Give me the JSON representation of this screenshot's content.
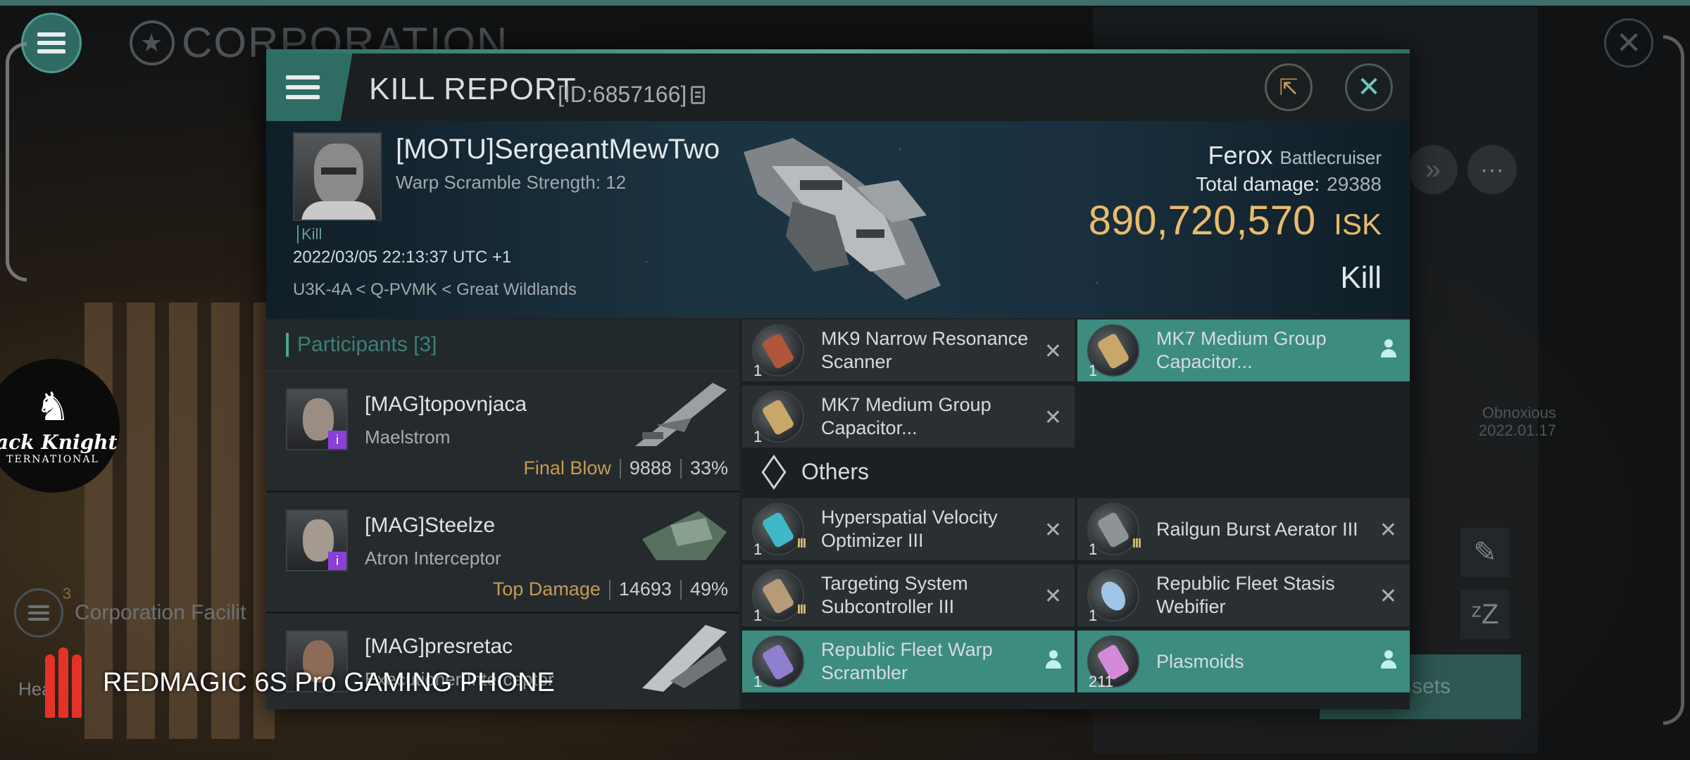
{
  "background": {
    "corp_title": "CORPORATION",
    "facility_label": "Corporation Facilit",
    "facility_count": "3",
    "heat_label": "Hea",
    "obnox_name": "Obnoxious",
    "obnox_date": "2022.01.17",
    "assets_label": "sets",
    "logo_name": "lack Knight",
    "logo_sub": "TERNATIONAL"
  },
  "watermark": "REDMAGIC 6S Pro GAMING PHONE",
  "header": {
    "title": "KILL REPORT",
    "id": "[ID:6857166]"
  },
  "victim": {
    "name": "[MOTU]SergeantMewTwo",
    "warp_scramble": "Warp Scramble Strength: 12",
    "kill_tag": "Kill",
    "datetime": "2022/03/05 22:13:37 UTC +1",
    "location": "U3K-4A < Q-PVMK < Great Wildlands",
    "ship": "Ferox",
    "ship_class": "Battlecruiser",
    "total_damage_label": "Total damage:",
    "total_damage": "29388",
    "isk_value": "890,720,570",
    "isk_unit": "ISK",
    "result": "Kill"
  },
  "participants": {
    "label": "Participants",
    "count": "[3]",
    "rows": [
      {
        "name": "[MAG]topovnjaca",
        "ship": "Maelstrom",
        "tag": "Final Blow",
        "damage": "9888",
        "percent": "33%"
      },
      {
        "name": "[MAG]Steelze",
        "ship": "Atron Interceptor",
        "tag": "Top Damage",
        "damage": "14693",
        "percent": "49%"
      },
      {
        "name": "[MAG]presretac",
        "ship": "Executioner Interceptor",
        "tag": "",
        "damage": "",
        "percent": ""
      }
    ]
  },
  "items": {
    "others_label": "Others",
    "list": [
      {
        "name": "MK9 Narrow Resonance Scanner",
        "qty": "1",
        "dropped": false,
        "tier": ""
      },
      {
        "name": "MK7 Medium Group Capacitor...",
        "qty": "1",
        "dropped": true,
        "tier": ""
      },
      {
        "name": "MK7 Medium Group Capacitor...",
        "qty": "1",
        "dropped": false,
        "tier": ""
      },
      {
        "name": "Hyperspatial Velocity Optimizer III",
        "qty": "1",
        "dropped": false,
        "tier": "III"
      },
      {
        "name": "Railgun Burst Aerator III",
        "qty": "1",
        "dropped": false,
        "tier": "III"
      },
      {
        "name": "Targeting System Subcontroller III",
        "qty": "1",
        "dropped": false,
        "tier": "III"
      },
      {
        "name": "Republic Fleet Stasis Webifier",
        "qty": "1",
        "dropped": false,
        "tier": ""
      },
      {
        "name": "Republic Fleet Warp Scrambler",
        "qty": "1",
        "dropped": true,
        "tier": ""
      },
      {
        "name": "Plasmoids",
        "qty": "211",
        "dropped": true,
        "tier": ""
      }
    ]
  },
  "colors": {
    "accent_teal": "#3c8c80",
    "isk_gold": "#e9bb6c",
    "tag_gold": "#c69a52"
  }
}
